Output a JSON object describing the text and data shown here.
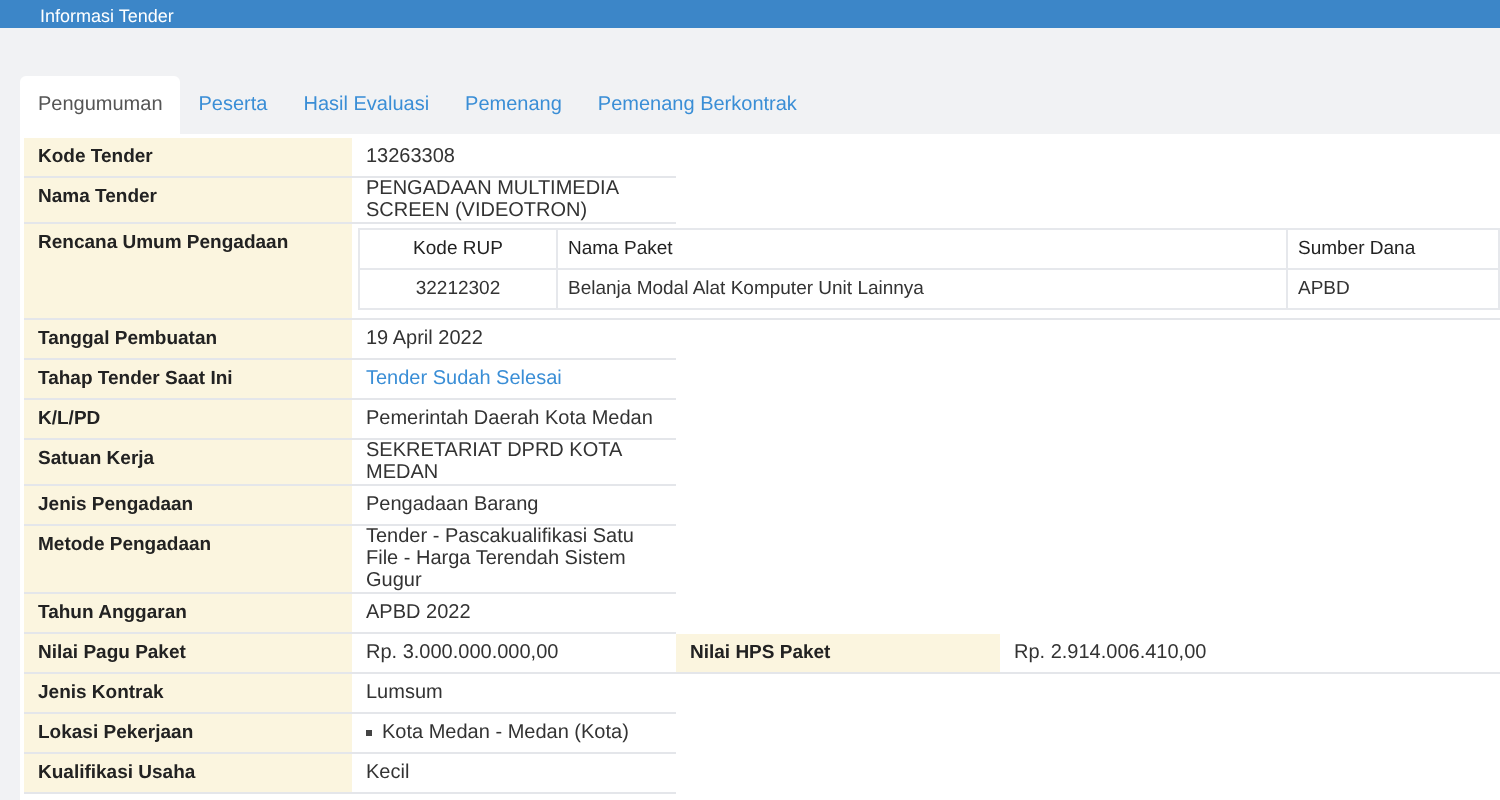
{
  "header": {
    "title": "Informasi Tender"
  },
  "tabs": [
    {
      "label": "Pengumuman",
      "selected": true
    },
    {
      "label": "Peserta",
      "selected": false
    },
    {
      "label": "Hasil Evaluasi",
      "selected": false
    },
    {
      "label": "Pemenang",
      "selected": false
    },
    {
      "label": "Pemenang Berkontrak",
      "selected": false
    }
  ],
  "rows": [
    {
      "kind": "text",
      "label": "Kode Tender",
      "value": "13263308"
    },
    {
      "kind": "text",
      "label": "Nama Tender",
      "value": "PENGADAAN MULTIMEDIA SCREEN (VIDEOTRON)"
    },
    {
      "kind": "table",
      "label": "Rencana Umum Pengadaan",
      "columns": [
        "Kode RUP",
        "Nama Paket",
        "Sumber Dana"
      ],
      "rows": [
        [
          "32212302",
          "Belanja Modal Alat Komputer Unit Lainnya",
          "APBD"
        ]
      ]
    },
    {
      "kind": "text",
      "label": "Tanggal Pembuatan",
      "value": "19 April 2022"
    },
    {
      "kind": "link",
      "label": "Tahap Tender Saat Ini",
      "value": "Tender Sudah Selesai"
    },
    {
      "kind": "text",
      "label": "K/L/PD",
      "value": "Pemerintah Daerah Kota Medan"
    },
    {
      "kind": "text",
      "label": "Satuan Kerja",
      "value": "SEKRETARIAT DPRD KOTA MEDAN"
    },
    {
      "kind": "text",
      "label": "Jenis Pengadaan",
      "value": "Pengadaan Barang"
    },
    {
      "kind": "text",
      "label": "Metode Pengadaan",
      "value": "Tender - Pascakualifikasi Satu File - Harga Terendah Sistem Gugur"
    },
    {
      "kind": "text",
      "label": "Tahun Anggaran",
      "value": "APBD 2022"
    },
    {
      "kind": "split",
      "label": "Nilai Pagu Paket",
      "value": "Rp. 3.000.000.000,00",
      "label2": "Nilai HPS Paket",
      "value2": "Rp. 2.914.006.410,00"
    },
    {
      "kind": "text",
      "label": "Jenis Kontrak",
      "value": "Lumsum"
    },
    {
      "kind": "list",
      "label": "Lokasi Pekerjaan",
      "items": [
        "Kota Medan - Medan (Kota)"
      ]
    },
    {
      "kind": "text",
      "label": "Kualifikasi Usaha",
      "value": "Kecil"
    }
  ]
}
